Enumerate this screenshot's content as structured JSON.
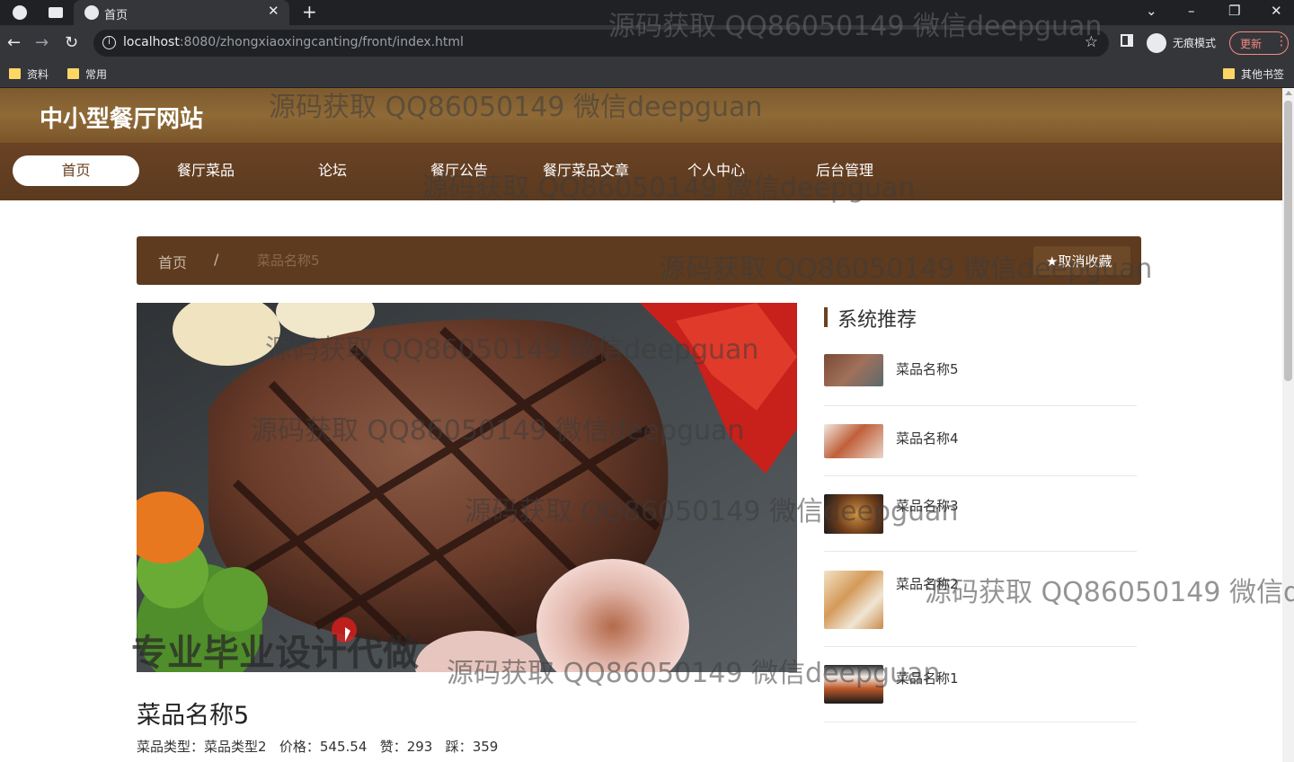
{
  "browser": {
    "tab_title": "首页",
    "url_host": "localhost",
    "url_rest": ":8080/zhongxiaoxingcanting/front/index.html",
    "incognito_label": "无痕模式",
    "update_label": "更新",
    "bookmarks": [
      "资料",
      "常用"
    ],
    "other_bookmarks": "其他书签"
  },
  "site": {
    "title": "中小型餐厅网站",
    "nav": [
      "首页",
      "餐厅菜品",
      "论坛",
      "餐厅公告",
      "餐厅菜品文章",
      "个人中心",
      "后台管理"
    ],
    "active_nav": "首页"
  },
  "breadcrumb": {
    "home": "首页",
    "separator": "/",
    "current": "菜品名称5",
    "fav_button": "取消收藏",
    "fav_icon": "star-icon"
  },
  "dish": {
    "title": "菜品名称5",
    "meta_type_label": "菜品类型：",
    "meta_type_value": "菜品类型2",
    "meta_price_label": "价格：",
    "meta_price_value": "545.54",
    "meta_like_label": "赞：",
    "meta_like_value": "293",
    "meta_dislike_label": "踩：",
    "meta_dislike_value": "359"
  },
  "recommend": {
    "title": "系统推荐",
    "items": [
      {
        "name": "菜品名称5"
      },
      {
        "name": "菜品名称4"
      },
      {
        "name": "菜品名称3"
      },
      {
        "name": "菜品名称2"
      },
      {
        "name": "菜品名称1"
      }
    ]
  },
  "watermarks": {
    "text": "源码获取 QQ86050149 微信deepguan",
    "text_cut": "源码获取 QQ86050149 微信de",
    "banner": "专业毕业设计代做"
  },
  "colors": {
    "header_brown": "#7d5a2e",
    "nav_brown": "#5b3a1f",
    "accent": "#6a4224"
  }
}
